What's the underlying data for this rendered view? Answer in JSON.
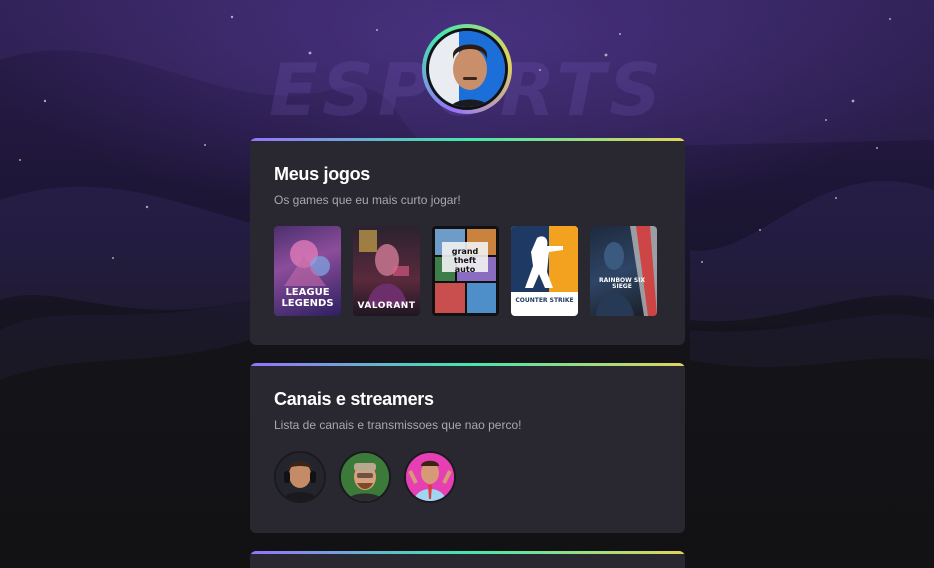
{
  "background": {
    "watermark": "ESPORTS"
  },
  "profile": {
    "avatar_icon": "user-avatar"
  },
  "accent_gradient": [
    "#9572fc",
    "#43e7ad",
    "#e2d45c"
  ],
  "games_section": {
    "title": "Meus jogos",
    "subtitle": "Os games que eu mais curto jogar!",
    "games": [
      {
        "name": "League of Legends",
        "line1": "LEAGUE",
        "line2": "LEGENDS",
        "icon": "league-of-legends-cover"
      },
      {
        "name": "Valorant",
        "label": "VALORANT",
        "icon": "valorant-cover"
      },
      {
        "name": "GTA V",
        "label": "grand theft auto",
        "icon": "gta-v-cover"
      },
      {
        "name": "Counter Strike",
        "label": "COUNTER STRIKE",
        "icon": "counter-strike-cover"
      },
      {
        "name": "Rainbow Six Siege",
        "label": "RAINBOW SIX SIEGE",
        "icon": "rainbow-six-siege-cover"
      }
    ]
  },
  "streamers_section": {
    "title": "Canais e streamers",
    "subtitle": "Lista de canais e transmissoes que nao perco!",
    "streamers": [
      {
        "icon": "streamer-1-avatar",
        "color": "#2b2b33"
      },
      {
        "icon": "streamer-2-avatar",
        "color": "#3f7d3a"
      },
      {
        "icon": "streamer-3-avatar",
        "color": "#e83fb5"
      }
    ]
  }
}
